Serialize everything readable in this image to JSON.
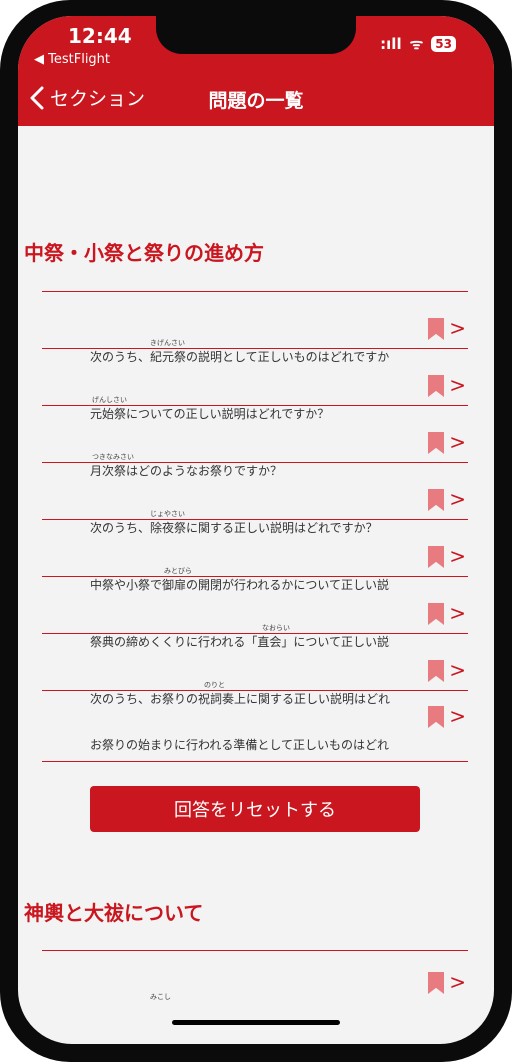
{
  "status": {
    "time": "12:44",
    "back_app": "◀ TestFlight",
    "signal": ":ıll",
    "wifi": "ᯤ",
    "battery": "53"
  },
  "nav": {
    "back_label": "セクション",
    "title": "問題の一覧"
  },
  "sections": [
    {
      "title": "中祭・小祭と祭りの進め方",
      "questions": [
        {
          "ruby": "きげんさい",
          "text": "次のうち、紀元祭の説明として正しいものはどれですか"
        },
        {
          "ruby": "げんしさい",
          "text": "元始祭についての正しい説明はどれですか？"
        },
        {
          "ruby": "つきなみさい",
          "text": "月次祭はどのようなお祭りですか？"
        },
        {
          "ruby": "じょやさい",
          "text": "次のうち、除夜祭に関する正しい説明はどれですか？"
        },
        {
          "ruby": "みとびら",
          "text": "中祭や小祭で御扉の開閉が行われるかについて正しい説明"
        },
        {
          "ruby": "なおらい",
          "text": "祭典の締めくくりに行われる「直会」について正しい説明"
        },
        {
          "ruby": "のりと",
          "text": "次のうち、お祭りの祝詞奏上に関する正しい説明はどれ"
        },
        {
          "ruby": "",
          "text": "お祭りの始まりに行われる準備として正しいものはどれ"
        }
      ]
    },
    {
      "title": "神輿と大祓について",
      "questions": [
        {
          "ruby": "みこし",
          "text": ""
        }
      ]
    }
  ],
  "reset_label": "回答をリセットする"
}
